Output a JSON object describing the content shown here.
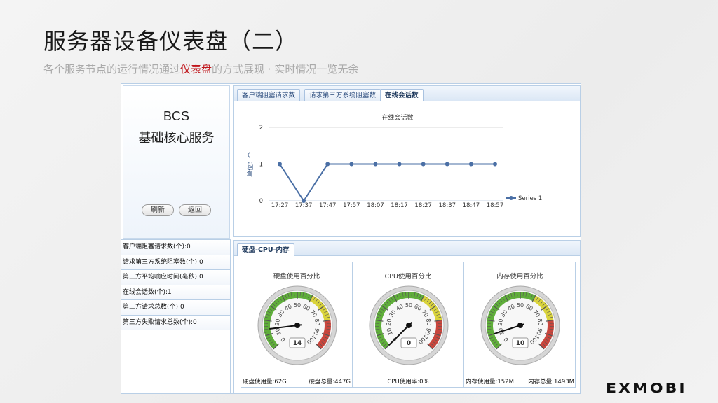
{
  "slide": {
    "title": "服务器设备仪表盘（二）",
    "subtitle_pre": "各个服务节点的运行情况通过",
    "subtitle_hl": "仪表盘",
    "subtitle_post": "的方式展现 · 实时情况一览无余",
    "logo": "EXMOBI"
  },
  "service": {
    "name": "BCS",
    "desc": "基础核心服务",
    "refresh_label": "刷新",
    "back_label": "返回"
  },
  "stats": [
    "客户端阻塞请求数(个):0",
    "请求第三方系统阻塞数(个):0",
    "第三方平均响应时间(毫秒):0",
    "在线会话数(个):1",
    "第三方请求总数(个):0",
    "第三方失败请求总数(个):0"
  ],
  "tabs": [
    "客户端阻塞请求数",
    "请求第三方系统阻塞数",
    "在线会话数"
  ],
  "active_tab": 2,
  "chart_data": {
    "type": "line",
    "title": "在线会话数",
    "ylabel": "单位：个",
    "xlabel": "",
    "ylim": [
      0,
      2
    ],
    "yticks": [
      "0",
      "1",
      "2"
    ],
    "categories": [
      "17:27",
      "17:37",
      "17:47",
      "17:57",
      "18:07",
      "18:17",
      "18:27",
      "18:37",
      "18:47",
      "18:57"
    ],
    "series": [
      {
        "name": "Series 1",
        "values": [
          1,
          0,
          1,
          1,
          1,
          1,
          1,
          1,
          1,
          1
        ],
        "color": "#4a6fa5"
      }
    ],
    "legend": "right",
    "grid": true
  },
  "gauge_tab": "硬盘-CPU-内存",
  "gauges": [
    {
      "title": "硬盘使用百分比",
      "value": 14,
      "display": "14",
      "foot_left": "硬盘使用量:62G",
      "foot_right": "硬盘总量:447G"
    },
    {
      "title": "CPU使用百分比",
      "value": 0,
      "display": "0",
      "foot_left": "",
      "foot_center": "CPU使用率:0%",
      "foot_right": ""
    },
    {
      "title": "内存使用百分比",
      "value": 10,
      "display": "10",
      "foot_left": "内存使用量:152M",
      "foot_right": "内存总量:1493M"
    }
  ],
  "gauge_scale": {
    "min": 0,
    "max": 100,
    "labels": [
      "0",
      "10",
      "20",
      "30",
      "40",
      "50",
      "60",
      "70",
      "80",
      "90",
      "100"
    ]
  },
  "colors": {
    "accent": "#4a6fa5",
    "highlight": "#c0161c",
    "gauge_green": "#5fae3a",
    "gauge_yellow": "#d9d33c",
    "gauge_red": "#c9463d"
  }
}
